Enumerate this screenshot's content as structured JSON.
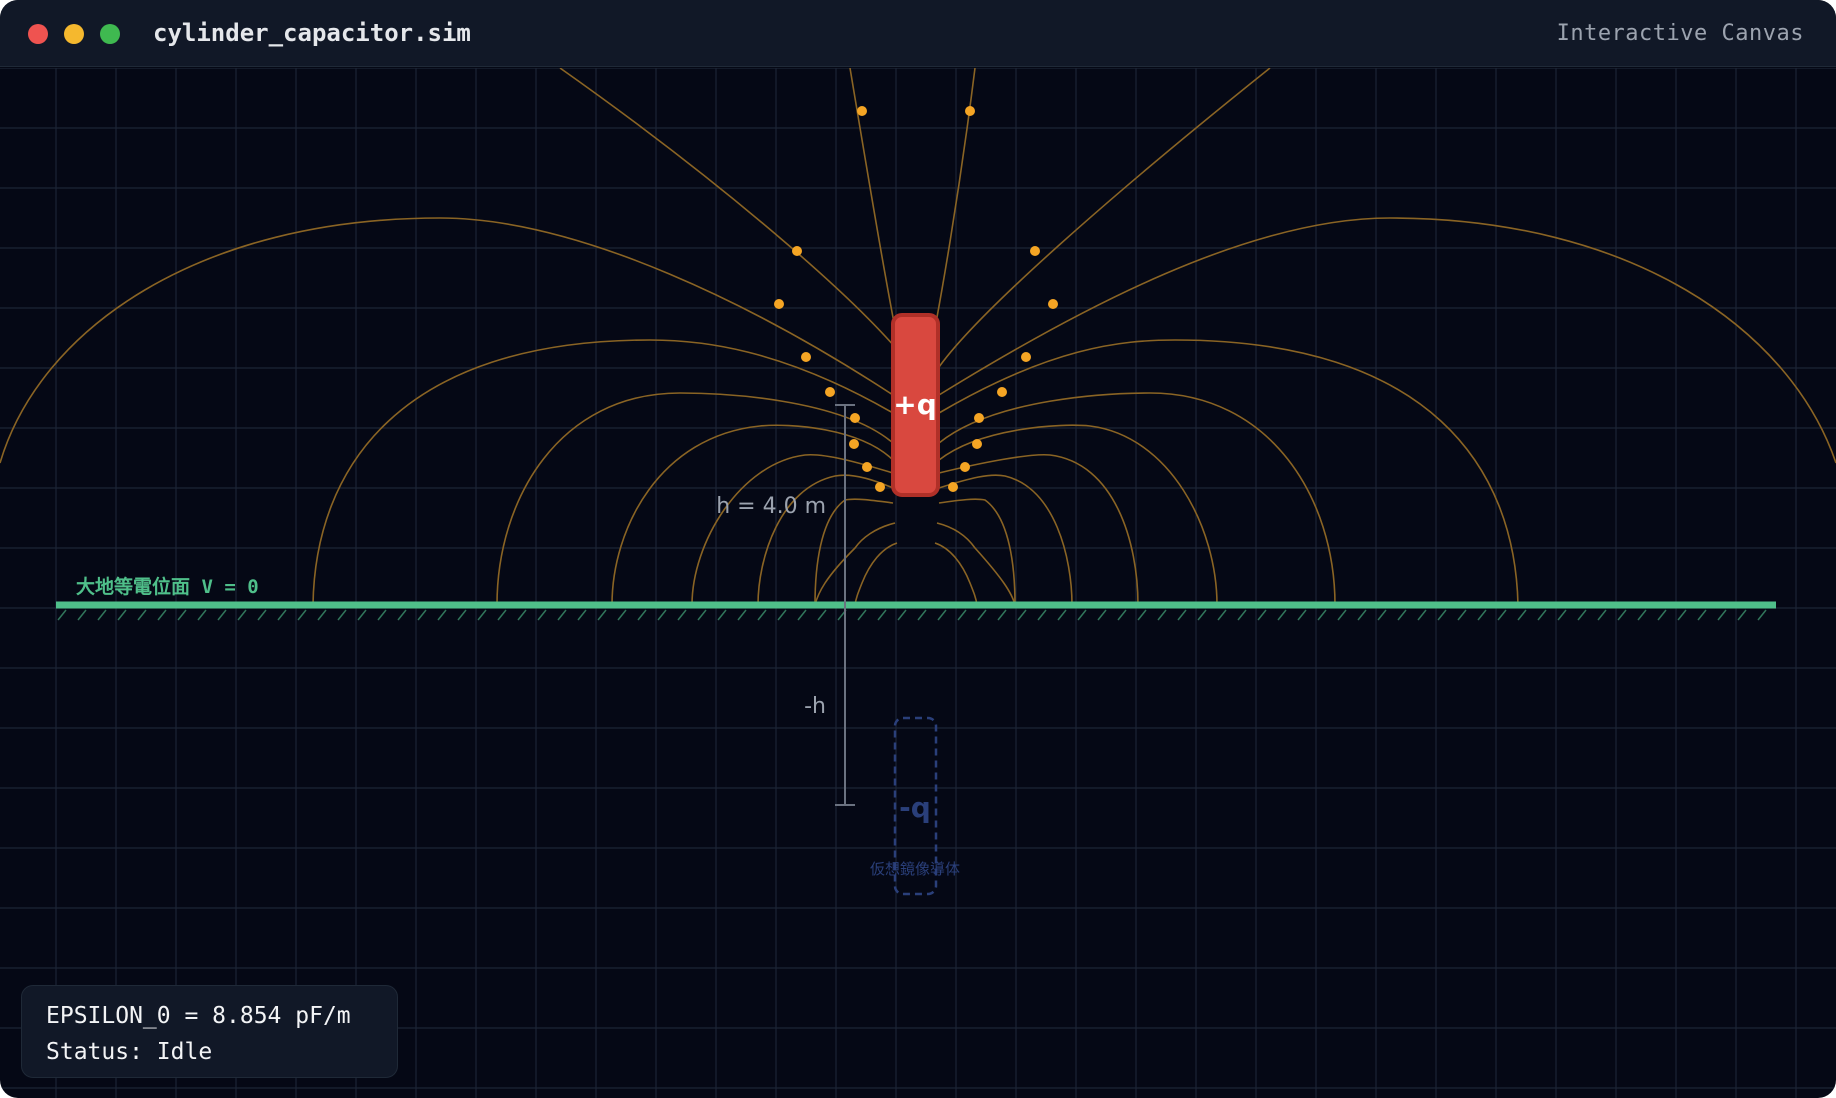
{
  "window": {
    "title": "cylinder_capacitor.sim",
    "mode_label": "Interactive Canvas",
    "traffic_lights": {
      "close": "#ef5350",
      "minimize": "#f5b82e",
      "maximize": "#3fb950"
    }
  },
  "canvas": {
    "colors": {
      "background": "#050815",
      "grid": "#1c2436",
      "field_line": "#8a6424",
      "field_dot": "#f5a524",
      "ground": "#4fbf8a",
      "conductor": "#d9483f",
      "conductor_border": "#b03028",
      "image_conductor": "#2a3f7a",
      "dimension": "#6b7280"
    },
    "ground_label": "大地等電位面 V = 0",
    "conductor_label": "+q",
    "image_label": "-q",
    "image_caption": "仮想鏡像導体",
    "height_label": "h = 4.0 m",
    "neg_height_label": "-h"
  },
  "info": {
    "epsilon_line": "EPSILON_0 = 8.854 pF/m",
    "status_line": "Status: Idle"
  }
}
